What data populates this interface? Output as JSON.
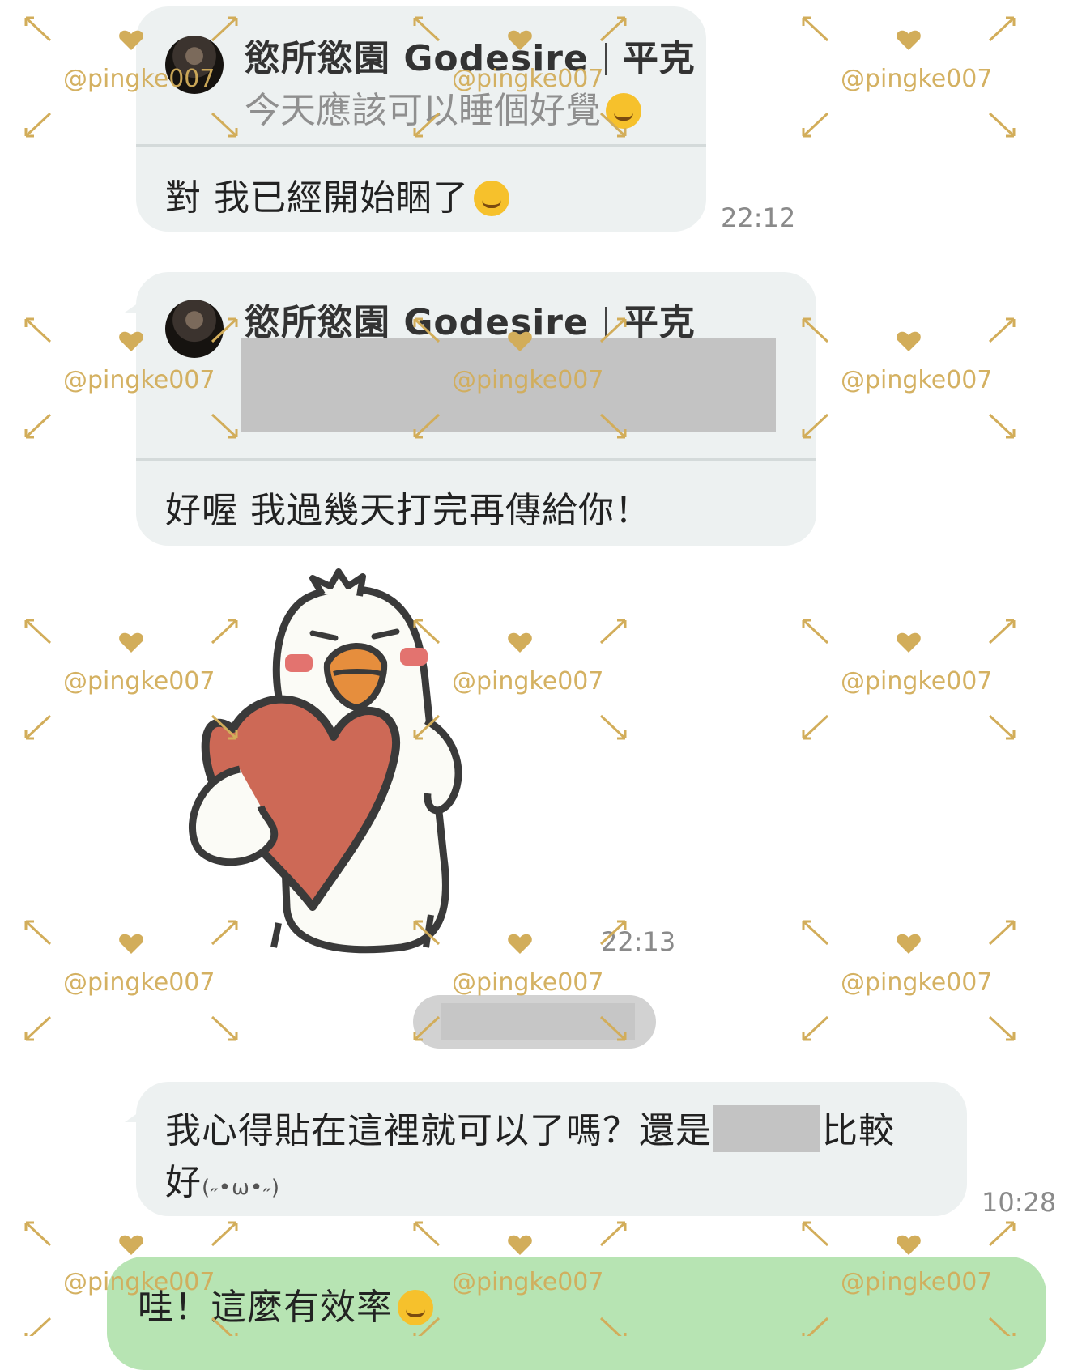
{
  "messages": [
    {
      "sender": {
        "name": "慾所慾園 Godesire",
        "separator": "|",
        "suffix": "平克"
      },
      "quoted_text": "今天應該可以睡個好覺",
      "quoted_emoji": "smiling-blush-emoji",
      "text": "對 我已經開始睏了",
      "emoji": "rofl-emoji",
      "time": "22:12"
    },
    {
      "sender": {
        "name": "慾所慾園 Godesire",
        "separator": "|",
        "suffix": "平克"
      },
      "text": "好喔 我過幾天打完再傳給你！"
    },
    {
      "sticker": "duck-holding-heart-sticker",
      "time": "22:13"
    },
    {
      "text_part1": "我心得貼在這裡就可以了嗎？還是",
      "text_part2": "比較",
      "text_part3": "好",
      "kaomoji": "(˶•ω•˶)",
      "time": "10:28"
    },
    {
      "text": "哇！這麼有效率",
      "emoji": "heart-eyes-emoji"
    }
  ],
  "watermark": {
    "text": "@pingke007",
    "icon": "heart-icon",
    "color": "#d2ad5a"
  },
  "colors": {
    "incoming_bubble": "#edf1f1",
    "outgoing_bubble": "#b7e4b3",
    "redaction": "#c3c3c3"
  }
}
